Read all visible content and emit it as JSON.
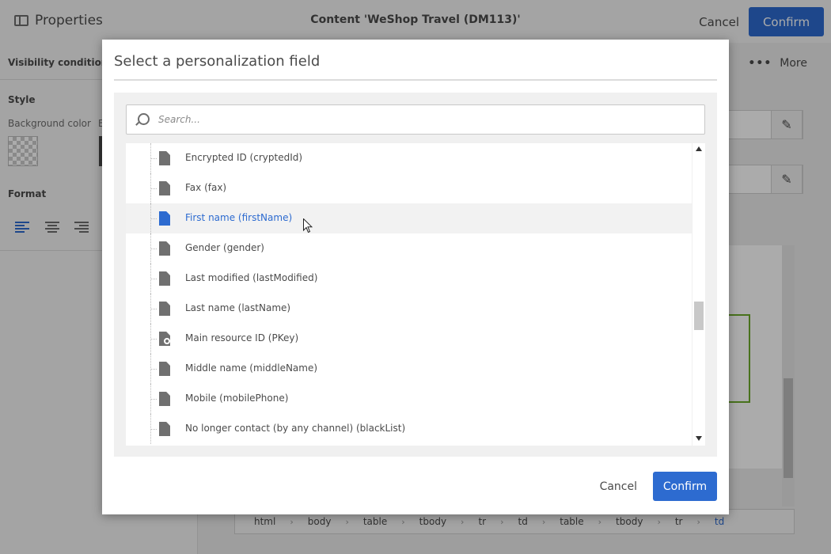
{
  "app": {
    "panel_title": "Properties",
    "content_title": "Content 'WeShop Travel (DM113)'",
    "cancel_label": "Cancel",
    "confirm_label": "Confirm",
    "more_label": "More",
    "more_dots": "•••"
  },
  "left_panel": {
    "visibility_label": "Visibility condition",
    "style_label": "Style",
    "background_color_label": "Background color",
    "second_label_fragment": "B",
    "format_label": "Format"
  },
  "breadcrumb": [
    "html",
    "body",
    "table",
    "tbody",
    "tr",
    "td",
    "table",
    "tbody",
    "tr",
    "td"
  ],
  "dialog": {
    "title": "Select a personalization field",
    "search_placeholder": "Search...",
    "items": [
      {
        "label": "Encrypted ID (cryptedId)",
        "icon": "file-icon"
      },
      {
        "label": "Fax (fax)",
        "icon": "file-icon"
      },
      {
        "label": "First name (firstName)",
        "icon": "file-icon",
        "selected": true
      },
      {
        "label": "Gender (gender)",
        "icon": "file-icon"
      },
      {
        "label": "Last modified (lastModified)",
        "icon": "file-icon"
      },
      {
        "label": "Last name (lastName)",
        "icon": "file-icon"
      },
      {
        "label": "Main resource ID (PKey)",
        "icon": "key-file-icon"
      },
      {
        "label": "Middle name (middleName)",
        "icon": "file-icon"
      },
      {
        "label": "Mobile (mobilePhone)",
        "icon": "file-icon"
      },
      {
        "label": "No longer contact (by any channel) (blackList)",
        "icon": "file-icon"
      }
    ],
    "cancel_label": "Cancel",
    "confirm_label": "Confirm"
  },
  "colors": {
    "accent": "#2d6bd0",
    "canvas_selection": "#6caa2b"
  }
}
